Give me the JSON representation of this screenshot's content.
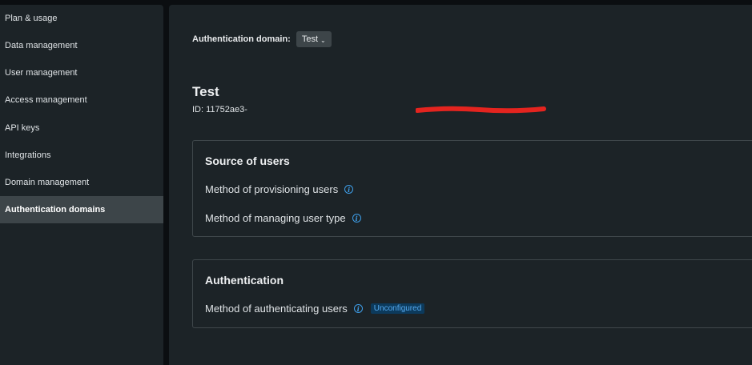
{
  "sidebar": {
    "items": [
      {
        "label": "Plan & usage"
      },
      {
        "label": "Data management"
      },
      {
        "label": "User management"
      },
      {
        "label": "Access management"
      },
      {
        "label": "API keys"
      },
      {
        "label": "Integrations"
      },
      {
        "label": "Domain management"
      },
      {
        "label": "Authentication domains",
        "active": true
      }
    ]
  },
  "header": {
    "domain_label": "Authentication domain:",
    "domain_value": "Test"
  },
  "domain": {
    "title": "Test",
    "id_prefix": "ID: 11752ae3-"
  },
  "sources_card": {
    "title": "Source of users",
    "rows": [
      {
        "label": "Method of provisioning users"
      },
      {
        "label": "Method of managing user type"
      }
    ]
  },
  "auth_card": {
    "title": "Authentication",
    "row_label": "Method of authenticating users",
    "status_badge": "Unconfigured"
  },
  "colors": {
    "accent": "#3e9ee8",
    "redaction": "#e4241f"
  }
}
